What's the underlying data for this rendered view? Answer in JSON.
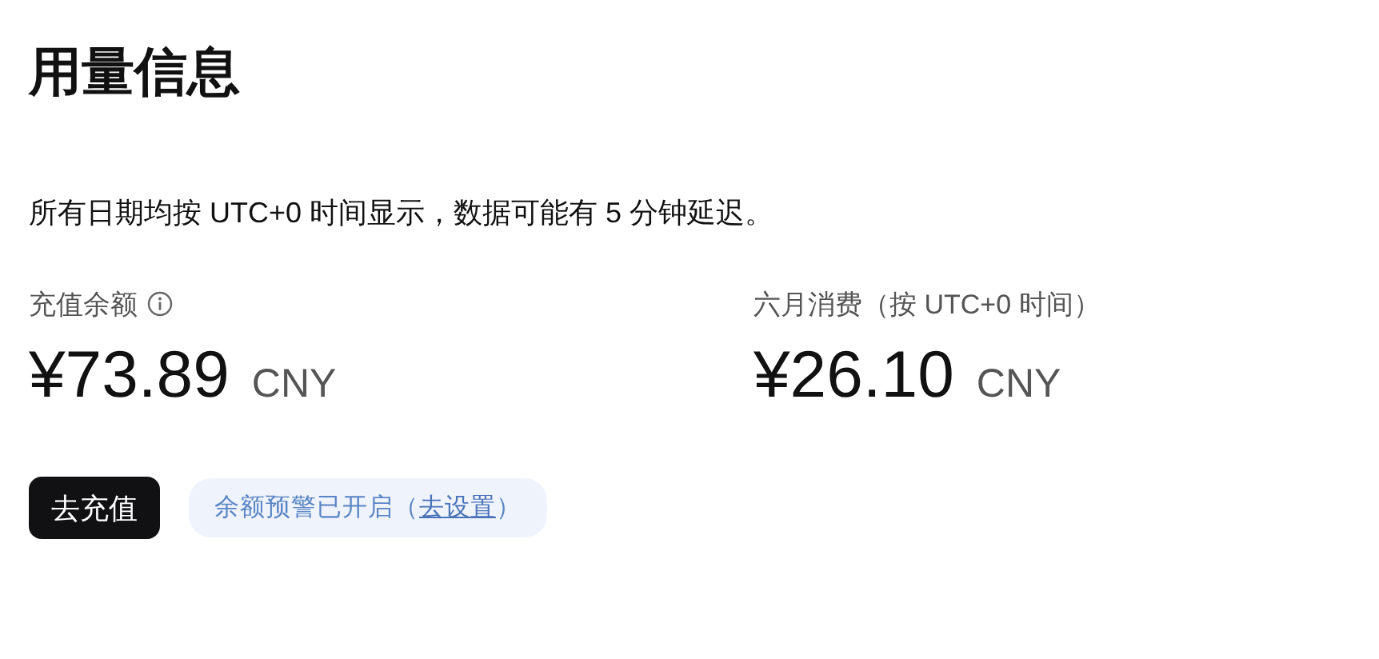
{
  "title": "用量信息",
  "note": "所有日期均按 UTC+0 时间显示，数据可能有 5 分钟延迟。",
  "stats": [
    {
      "label": "充值余额",
      "info_icon": true,
      "amount": "¥73.89",
      "currency": "CNY"
    },
    {
      "label": "六月消费（按 UTC+0 时间）",
      "info_icon": false,
      "amount": "¥26.10",
      "currency": "CNY"
    }
  ],
  "topup_button": "去充值",
  "alert": {
    "text": "余额预警已开启（",
    "link": "去设置",
    "suffix": "）"
  }
}
